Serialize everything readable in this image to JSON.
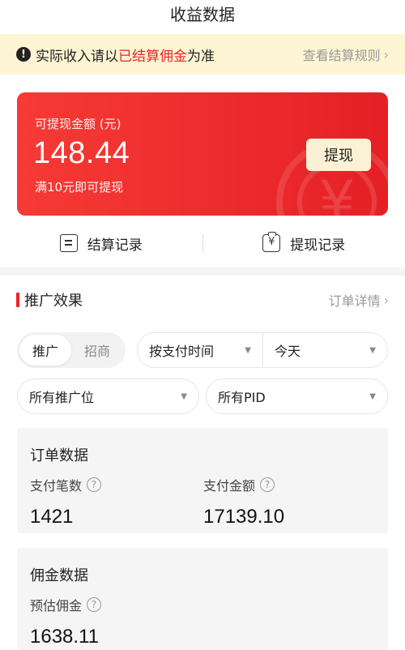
{
  "header": {
    "title": "收益数据"
  },
  "notice": {
    "prefix": "实际收入请以",
    "highlight": "已结算佣金",
    "suffix": "为准",
    "rules_link": "查看结算规则",
    "chevron": "›"
  },
  "balance_card": {
    "label": "可提现金额 (元)",
    "amount": "148.44",
    "tip": "满10元即可提现",
    "withdraw_button": "提现",
    "watermark_icon": "yuan-coin-icon",
    "watermark_glyph": "¥"
  },
  "records": {
    "settlement": "结算记录",
    "withdrawal": "提现记录"
  },
  "promotion": {
    "title": "推广效果",
    "detail_link": "订单详情",
    "chevron": "›",
    "segment": [
      "推广",
      "招商"
    ],
    "filters": {
      "pay_time": "按支付时间",
      "date": "今天",
      "position": "所有推广位",
      "pid": "所有PID"
    },
    "caret": "▼"
  },
  "order_data": {
    "title": "订单数据",
    "pay_count_label": "支付笔数",
    "pay_count_value": "1421",
    "pay_amount_label": "支付金额",
    "pay_amount_value": "17139.10"
  },
  "commission_data": {
    "title": "佣金数据",
    "estimated_label": "预估佣金",
    "estimated_value": "1638.11"
  },
  "help_glyph": "?",
  "colors": {
    "accent": "#e8252a",
    "notice_bg": "#fdf5d3",
    "button_bg": "#fdf1d5"
  }
}
